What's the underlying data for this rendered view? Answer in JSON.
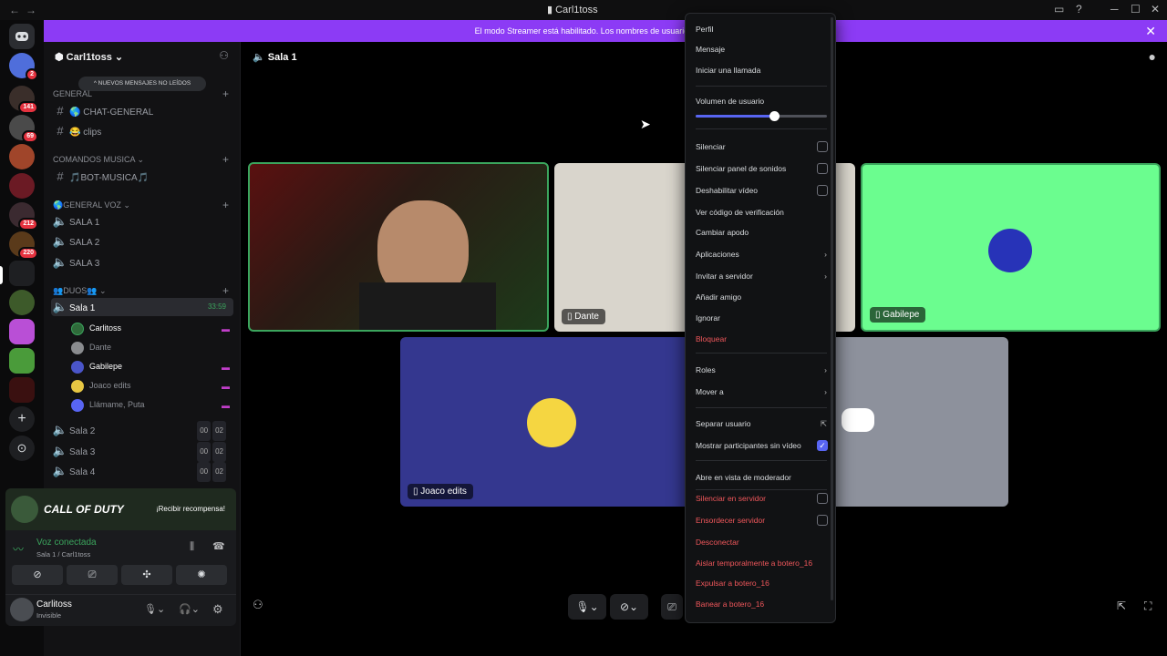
{
  "window": {
    "title": "Carl1toss"
  },
  "banner": {
    "text": "El modo Streamer está habilitado. Los nombres de usuario se han trunc"
  },
  "rail": {
    "badges": [
      "2",
      "141",
      "69",
      "212",
      "220"
    ]
  },
  "server": {
    "name": "Carl1toss"
  },
  "unread_pill": "NUEVOS MENSAJES NO LEÍDOS",
  "categories": {
    "general": "GENERAL",
    "comandos": "COMANDOS MUSICA",
    "general_voz": "GENERAL VOZ",
    "duos": "DUOS"
  },
  "channels": {
    "chat_general": "CHAT-GENERAL",
    "clips": "clips",
    "bot_musica": "BOT-MUSICA",
    "sala1_voz": "SALA 1",
    "sala2_voz": "SALA 2",
    "sala3_voz": "SALA 3",
    "sala1": "Sala 1",
    "sala1_time": "33:59",
    "sala2": "Sala 2",
    "sala3": "Sala 3",
    "sala4": "Sala 4",
    "count_a": "00",
    "count_b": "02"
  },
  "members": [
    "Carlitoss",
    "Dante",
    "Gabilepe",
    "Joaco edits",
    "Llámame, Puta"
  ],
  "promo": {
    "brand": "CALL OF DUTY",
    "cta": "¡Recibir recompensa!"
  },
  "voice": {
    "status": "Voz conectada",
    "location": "Sala 1 / Carl1toss"
  },
  "user": {
    "name": "Carlitoss",
    "status": "Invisible"
  },
  "main": {
    "channel": "Sala 1"
  },
  "tiles": {
    "dante": "Dante",
    "gabilepe": "Gabilepe",
    "joaco": "Joaco edits"
  },
  "menu": {
    "perfil": "Perfil",
    "mensaje": "Mensaje",
    "llamada": "Iniciar una llamada",
    "volumen": "Volumen de usuario",
    "volumen_level": 0.6,
    "silenciar": "Silenciar",
    "silenciar_sonidos": "Silenciar panel de sonidos",
    "deshabilitar_video": "Deshabilitar vídeo",
    "codigo": "Ver código de verificación",
    "apodo": "Cambiar apodo",
    "aplicaciones": "Aplicaciones",
    "invitar": "Invitar a servidor",
    "anadir": "Añadir amigo",
    "ignorar": "Ignorar",
    "bloquear": "Bloquear",
    "roles": "Roles",
    "mover": "Mover a",
    "separar": "Separar usuario",
    "mostrar": "Mostrar participantes sin vídeo",
    "moderador": "Abre en vista de moderador",
    "silenciar_servidor": "Silenciar en servidor",
    "ensordecer": "Ensordecer servidor",
    "desconectar": "Desconectar",
    "aislar": "Aislar temporalmente a botero_16",
    "expulsar": "Expulsar a botero_16",
    "banear": "Banear a botero_16"
  }
}
